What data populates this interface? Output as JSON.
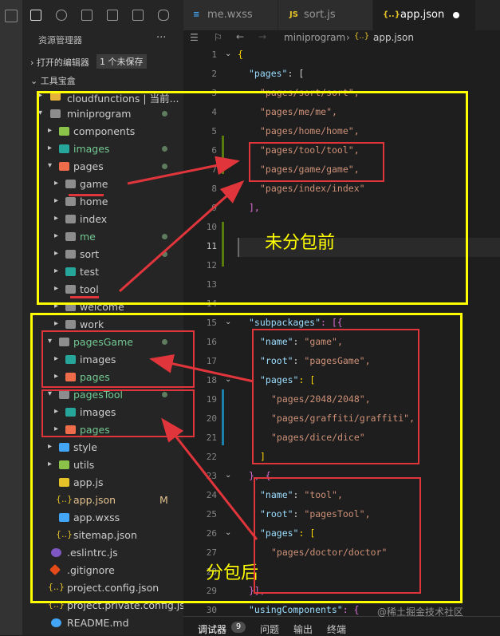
{
  "tabs": [
    {
      "name": "me.wxss",
      "icon": "css-icon",
      "active": false
    },
    {
      "name": "sort.js",
      "icon": "js-icon",
      "active": false
    },
    {
      "name": "app.json",
      "icon": "json-icon",
      "active": true
    }
  ],
  "breadcrumb": [
    "miniprogram",
    "app.json"
  ],
  "sidebar": {
    "title": "资源管理器",
    "more": "···",
    "open_editors": "打开的编辑器",
    "unsaved_badge": "1 个未保存",
    "workspace": "工具宝盒",
    "tree": [
      {
        "label": "cloudfunctions | 当前...",
        "icon": "folder-cloud-icon"
      },
      {
        "label": "miniprogram",
        "icon": "folder-icon"
      },
      {
        "label": "components",
        "icon": "folder-components-icon"
      },
      {
        "label": "images",
        "icon": "folder-images-icon"
      },
      {
        "label": "pages",
        "icon": "folder-pages-icon"
      },
      {
        "label": "game",
        "icon": "folder-icon"
      },
      {
        "label": "home",
        "icon": "folder-icon"
      },
      {
        "label": "index",
        "icon": "folder-icon"
      },
      {
        "label": "me",
        "icon": "folder-icon"
      },
      {
        "label": "sort",
        "icon": "folder-icon"
      },
      {
        "label": "test",
        "icon": "folder-test-icon"
      },
      {
        "label": "tool",
        "icon": "folder-icon"
      },
      {
        "label": "welcome",
        "icon": "folder-icon"
      },
      {
        "label": "work",
        "icon": "folder-icon"
      },
      {
        "label": "pagesGame",
        "icon": "folder-icon"
      },
      {
        "label": "images",
        "icon": "folder-images-icon"
      },
      {
        "label": "pages",
        "icon": "folder-pages-icon"
      },
      {
        "label": "pagesTool",
        "icon": "folder-icon"
      },
      {
        "label": "images",
        "icon": "folder-images-icon"
      },
      {
        "label": "pages",
        "icon": "folder-pages-icon"
      },
      {
        "label": "style",
        "icon": "folder-style-icon"
      },
      {
        "label": "utils",
        "icon": "folder-utils-icon"
      },
      {
        "label": "app.js",
        "icon": "js-icon"
      },
      {
        "label": "app.json",
        "icon": "json-icon",
        "status": "M"
      },
      {
        "label": "app.wxss",
        "icon": "css-icon"
      },
      {
        "label": "sitemap.json",
        "icon": "json-icon"
      },
      {
        "label": ".eslintrc.js",
        "icon": "eslint-icon"
      },
      {
        "label": ".gitignore",
        "icon": "git-icon"
      },
      {
        "label": "project.config.json",
        "icon": "json-icon"
      },
      {
        "label": "project.private.config.js...",
        "icon": "json-icon"
      },
      {
        "label": "README.md",
        "icon": "info-icon"
      }
    ]
  },
  "editor": {
    "lines": [
      "1",
      "2",
      "3",
      "4",
      "5",
      "6",
      "7",
      "8",
      "9",
      "10",
      "11",
      "12",
      "13",
      "14",
      "15",
      "16",
      "17",
      "18",
      "19",
      "20",
      "21",
      "22",
      "23",
      "24",
      "25",
      "26",
      "27",
      "28",
      "29",
      "30"
    ],
    "code": {
      "l1": "{",
      "l2_key": "\"pages\"",
      "l2_rest": ": [",
      "l3": "\"pages/sort/sort\",",
      "l4": "\"pages/me/me\",",
      "l5": "\"pages/home/home\",",
      "l6": "\"pages/tool/tool\",",
      "l7": "\"pages/game/game\",",
      "l8": "\"pages/index/index\"",
      "l9": "],",
      "l15_key": "\"subpackages\"",
      "l15_rest": ": [{",
      "l16_key": "\"name\"",
      "l16_val": "\"game\",",
      "l17_key": "\"root\"",
      "l17_val": "\"pagesGame\",",
      "l18_key": "\"pages\"",
      "l18_rest": ": [",
      "l19": "\"pages/2048/2048\",",
      "l20": "\"pages/graffiti/graffiti\",",
      "l21": "\"pages/dice/dice\"",
      "l22": "]",
      "l23": "}, {",
      "l24_key": "\"name\"",
      "l24_val": "\"tool\",",
      "l25_key": "\"root\"",
      "l25_val": "\"pagesTool\",",
      "l26_key": "\"pages\"",
      "l26_rest": ": [",
      "l27": "\"pages/doctor/doctor\"",
      "l29": "}],",
      "l30_key": "\"usingComponents\"",
      "l30_rest": ": {"
    }
  },
  "annotations": {
    "before": "未分包前",
    "after": "分包后"
  },
  "panel": {
    "debugger": "调试器",
    "debugger_count": "9",
    "problems": "问题",
    "output": "输出",
    "terminal": "终端"
  },
  "watermark": "@稀土掘金技术社区",
  "colors": {
    "annotation_yellow": "#ffff00",
    "annotation_red": "#e0353b",
    "editor_bg": "#1e1e1e"
  }
}
